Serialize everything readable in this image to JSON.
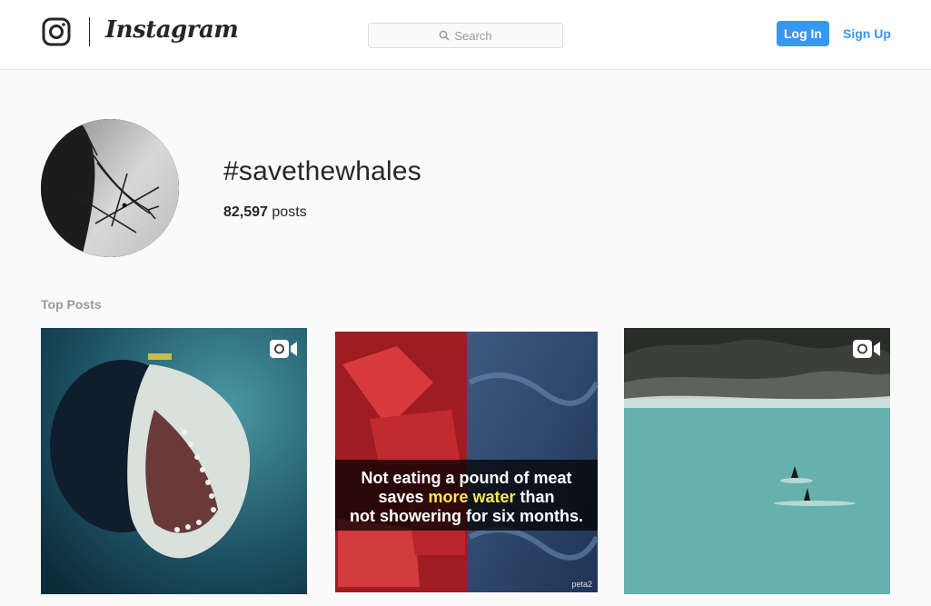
{
  "header": {
    "wordmark": "Instagram",
    "search_placeholder": "Search",
    "login_label": "Log In",
    "signup_label": "Sign Up",
    "accent_color": "#3897f0"
  },
  "hashtag": {
    "title": "#savethewhales",
    "post_count": "82,597",
    "post_count_suffix": "posts"
  },
  "top_posts": {
    "label": "Top Posts",
    "items": [
      {
        "subject": "orca with open mouth underwater",
        "is_video": true,
        "icon": "video-camera-icon"
      },
      {
        "subject": "raw meat and water split image",
        "is_video": false,
        "caption_line1": "Not eating a pound of meat",
        "caption_pre": "saves ",
        "caption_highlight": "more water",
        "caption_post": " than",
        "caption_line3": "not showering for six months.",
        "watermark": "peta2"
      },
      {
        "subject": "orcas fins in a bay near rocky shore",
        "is_video": true,
        "icon": "video-camera-icon"
      }
    ]
  }
}
